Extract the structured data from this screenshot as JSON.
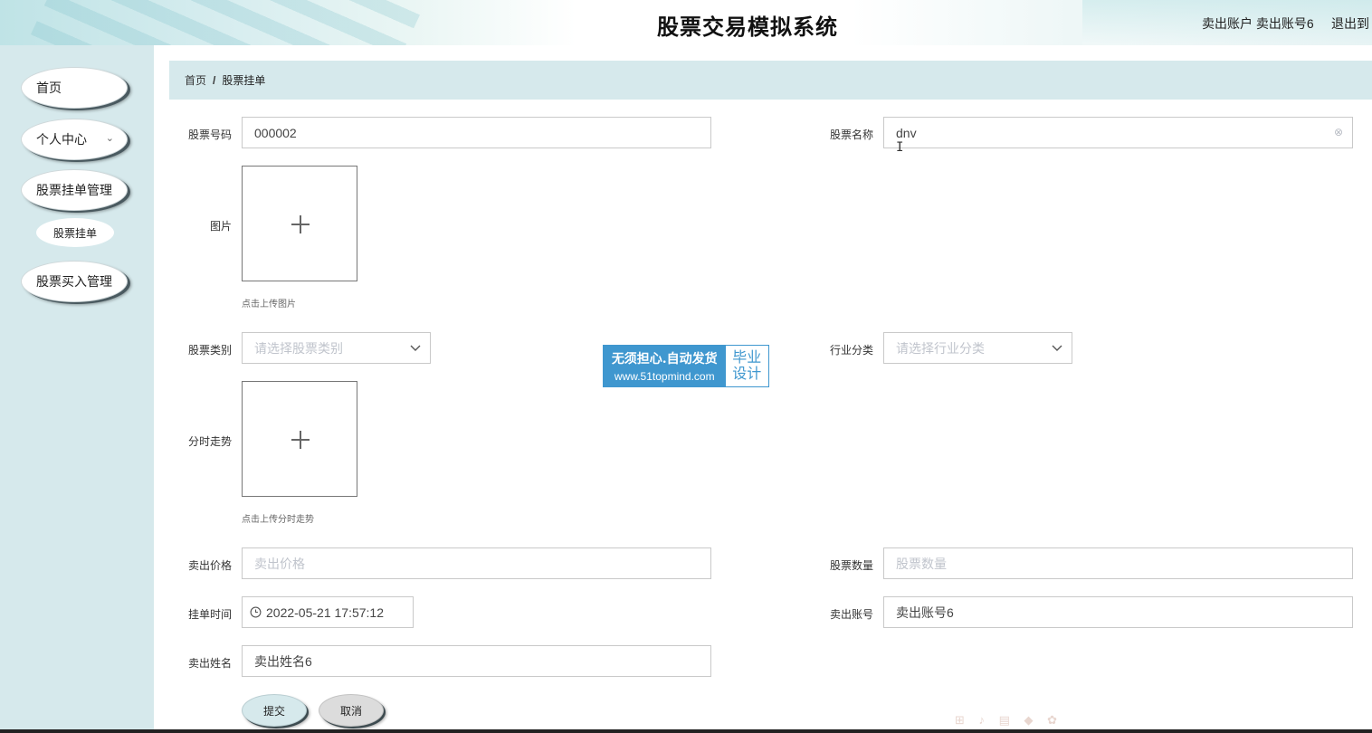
{
  "header": {
    "title": "股票交易模拟系统",
    "user_label": "卖出账户 卖出账号6",
    "logout_label": "退出到"
  },
  "sidebar": {
    "items": [
      {
        "label": "首页"
      },
      {
        "label": "个人中心",
        "chevron": "⌄"
      },
      {
        "label": "股票挂单管理"
      },
      {
        "label": "股票挂单"
      },
      {
        "label": "股票买入管理"
      }
    ]
  },
  "breadcrumb": {
    "home": "首页",
    "separator": "/",
    "current": "股票挂单"
  },
  "form": {
    "stock_code": {
      "label": "股票号码",
      "value": "000002"
    },
    "stock_name": {
      "label": "股票名称",
      "value": "dnv"
    },
    "image": {
      "label": "图片",
      "hint": "点击上传图片"
    },
    "stock_category": {
      "label": "股票类别",
      "placeholder": "请选择股票类别"
    },
    "industry": {
      "label": "行业分类",
      "placeholder": "请选择行业分类"
    },
    "trend": {
      "label": "分时走势",
      "hint": "点击上传分时走势"
    },
    "sell_price": {
      "label": "卖出价格",
      "placeholder": "卖出价格"
    },
    "quantity": {
      "label": "股票数量",
      "placeholder": "股票数量"
    },
    "order_time": {
      "label": "挂单时间",
      "value": "2022-05-21 17:57:12"
    },
    "seller_account": {
      "label": "卖出账号",
      "value": "卖出账号6"
    },
    "seller_name": {
      "label": "卖出姓名",
      "value": "卖出姓名6"
    },
    "submit_label": "提交",
    "cancel_label": "取消"
  },
  "watermark": {
    "line1": "无须担心.自动发货",
    "line2": "www.51topmind.com",
    "badge_top": "毕业",
    "badge_bottom": "设计"
  },
  "colors": {
    "sidebar_bg": "#d6e9ec",
    "breadcrumb_bg": "#d6e9ec",
    "watermark_blue": "#3f97cf"
  }
}
